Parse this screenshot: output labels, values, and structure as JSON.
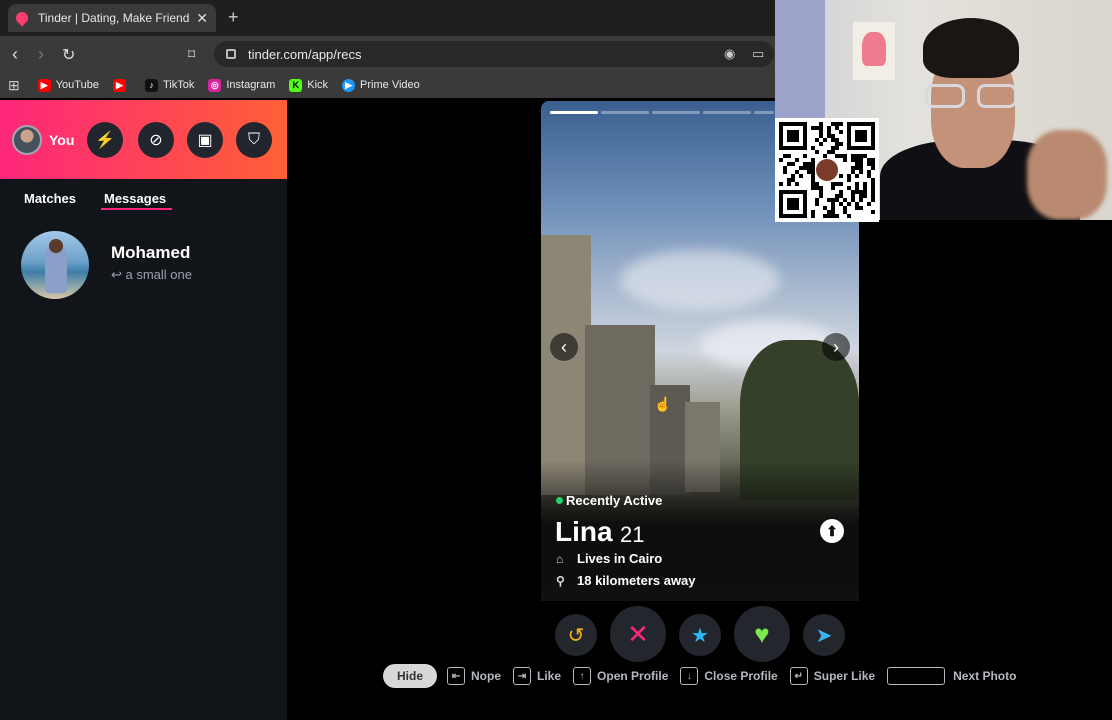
{
  "browser": {
    "tab_title": "Tinder | Dating, Make Friends &",
    "tab_close": "✕",
    "new_tab": "+",
    "url": "tinder.com/app/recs",
    "bookmarks": [
      {
        "label": "YouTube",
        "color": "#ff0000",
        "icon": "youtube-icon"
      },
      {
        "label": "",
        "color": "#ff0000",
        "icon": "youtube-icon"
      },
      {
        "label": "TikTok",
        "color": "#111111",
        "icon": "tiktok-icon"
      },
      {
        "label": "Instagram",
        "color": "#d6249f",
        "icon": "instagram-icon"
      },
      {
        "label": "Kick",
        "color": "#53fc18",
        "icon": "kick-icon"
      },
      {
        "label": "Prime Video",
        "color": "#1a98ff",
        "icon": "prime-video-icon"
      }
    ]
  },
  "sidebar": {
    "profile_label": "You",
    "header_buttons": [
      "boost-icon",
      "explore-icon",
      "work-icon",
      "safety-shield-icon"
    ],
    "tabs": [
      {
        "label": "Matches",
        "active": false
      },
      {
        "label": "Messages",
        "active": true
      }
    ],
    "messages": [
      {
        "name": "Mohamed",
        "preview": "↩ a small one"
      }
    ]
  },
  "card": {
    "photo_count": 5,
    "current_photo": 1,
    "status": "Recently Active",
    "name": "Lina",
    "age": "21",
    "lives_in": "Lives in Cairo",
    "distance": "18 kilometers away"
  },
  "actions": [
    {
      "name": "rewind-button",
      "glyph": "↺",
      "color": "#f9b21b",
      "big": false
    },
    {
      "name": "nope-button",
      "glyph": "✕",
      "color": "#fd267a",
      "big": true
    },
    {
      "name": "super-like-button",
      "glyph": "★",
      "color": "#2db7f5",
      "big": false
    },
    {
      "name": "like-button",
      "glyph": "♥",
      "color": "#7ce84e",
      "big": true
    },
    {
      "name": "boost-button",
      "glyph": "➤",
      "color": "#3ab4f2",
      "big": false
    }
  ],
  "hints": {
    "hide": "Hide",
    "nope": "Nope",
    "like": "Like",
    "open_profile": "Open Profile",
    "close_profile": "Close Profile",
    "super_like": "Super Like",
    "next_photo": "Next Photo"
  },
  "colors": {
    "brand_start": "#fd267a",
    "brand_end": "#ff6036",
    "online": "#22d46a"
  }
}
